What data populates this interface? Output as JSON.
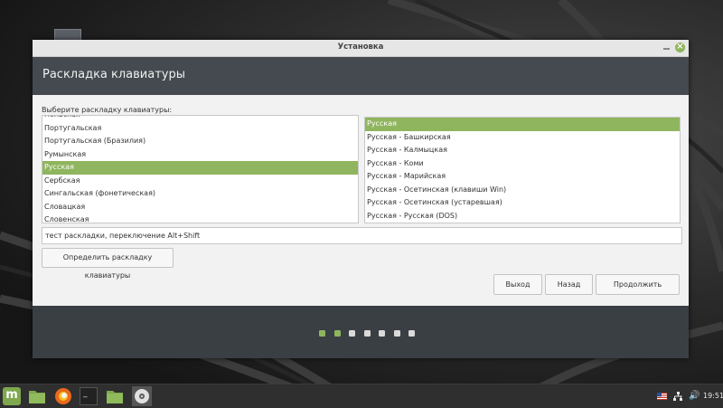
{
  "window": {
    "title": "Установка",
    "header_title": "Раскладка клавиатуры",
    "prompt": "Выберите раскладку клавиатуры:",
    "layouts": [
      {
        "label": "Польская",
        "selected": false
      },
      {
        "label": "Португальская",
        "selected": false
      },
      {
        "label": "Португальская (Бразилия)",
        "selected": false
      },
      {
        "label": "Румынская",
        "selected": false
      },
      {
        "label": "Русская",
        "selected": true
      },
      {
        "label": "Сербская",
        "selected": false
      },
      {
        "label": "Сингальская (фонетическая)",
        "selected": false
      },
      {
        "label": "Словацкая",
        "selected": false
      },
      {
        "label": "Словенская",
        "selected": false
      }
    ],
    "variants": [
      {
        "label": "Русская",
        "selected": true
      },
      {
        "label": "Русская - Башкирская",
        "selected": false
      },
      {
        "label": "Русская - Калмыцкая",
        "selected": false
      },
      {
        "label": "Русская - Коми",
        "selected": false
      },
      {
        "label": "Русская - Марийская",
        "selected": false
      },
      {
        "label": "Русская - Осетинская (клавиши Win)",
        "selected": false
      },
      {
        "label": "Русская - Осетинская (устаревшая)",
        "selected": false
      },
      {
        "label": "Русская - Русская (DOS)",
        "selected": false
      }
    ],
    "test_input_value": "тест раскладки, переключение Alt+Shift",
    "detect_button": "Определить раскладку клавиатуры",
    "buttons": {
      "quit": "Выход",
      "back": "Назад",
      "next": "Продолжить"
    },
    "progress": {
      "total_steps": 7,
      "completed_steps": 2
    }
  },
  "taskbar": {
    "apps": [
      "mint-menu-icon",
      "folder-icon",
      "firefox-icon",
      "terminal-icon",
      "folder-icon",
      "disc-icon"
    ],
    "clock": "19:51"
  },
  "colors": {
    "accent": "#8fb55e",
    "header": "#444a4f",
    "footer": "#3a3f44",
    "taskbar": "#2f2f2f"
  }
}
